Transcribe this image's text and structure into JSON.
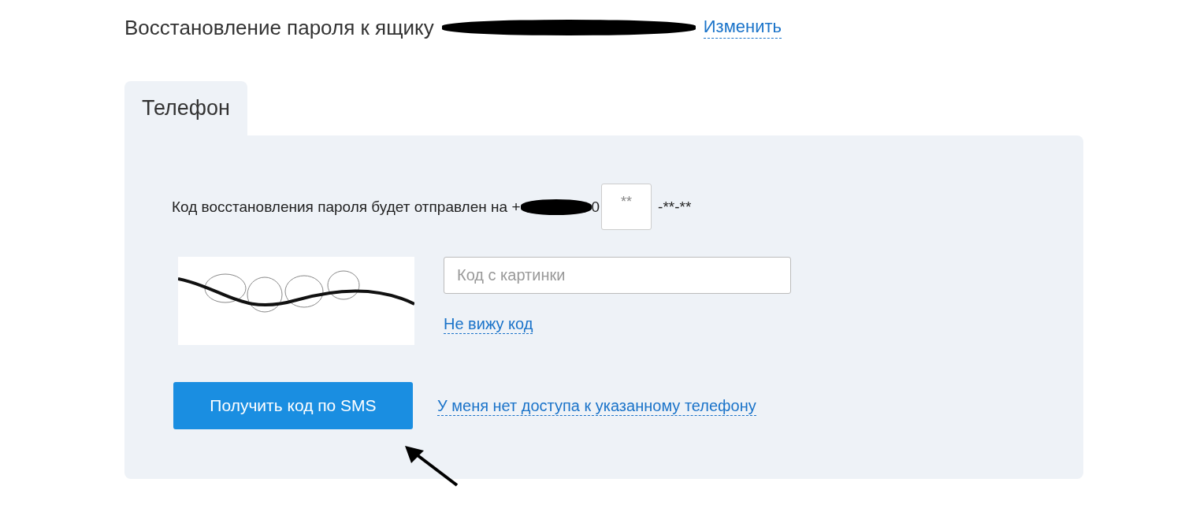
{
  "heading": {
    "text": "Восстановление пароля к ящику",
    "change_link": "Изменить"
  },
  "tabs": [
    {
      "label": "Телефон",
      "selected": true
    }
  ],
  "phone_line": {
    "text": "Код восстановления пароля будет отправлен на",
    "prefix": "+",
    "suffix": "0",
    "digits_placeholder": "**",
    "tail": "-**-**"
  },
  "captcha": {
    "kind": "picture",
    "placeholder": "Код с картинки",
    "refresh_link": "Не вижу код"
  },
  "submit_button": "Получить код по SMS",
  "no_access_link": "У меня нет доступа к указанному телефону"
}
